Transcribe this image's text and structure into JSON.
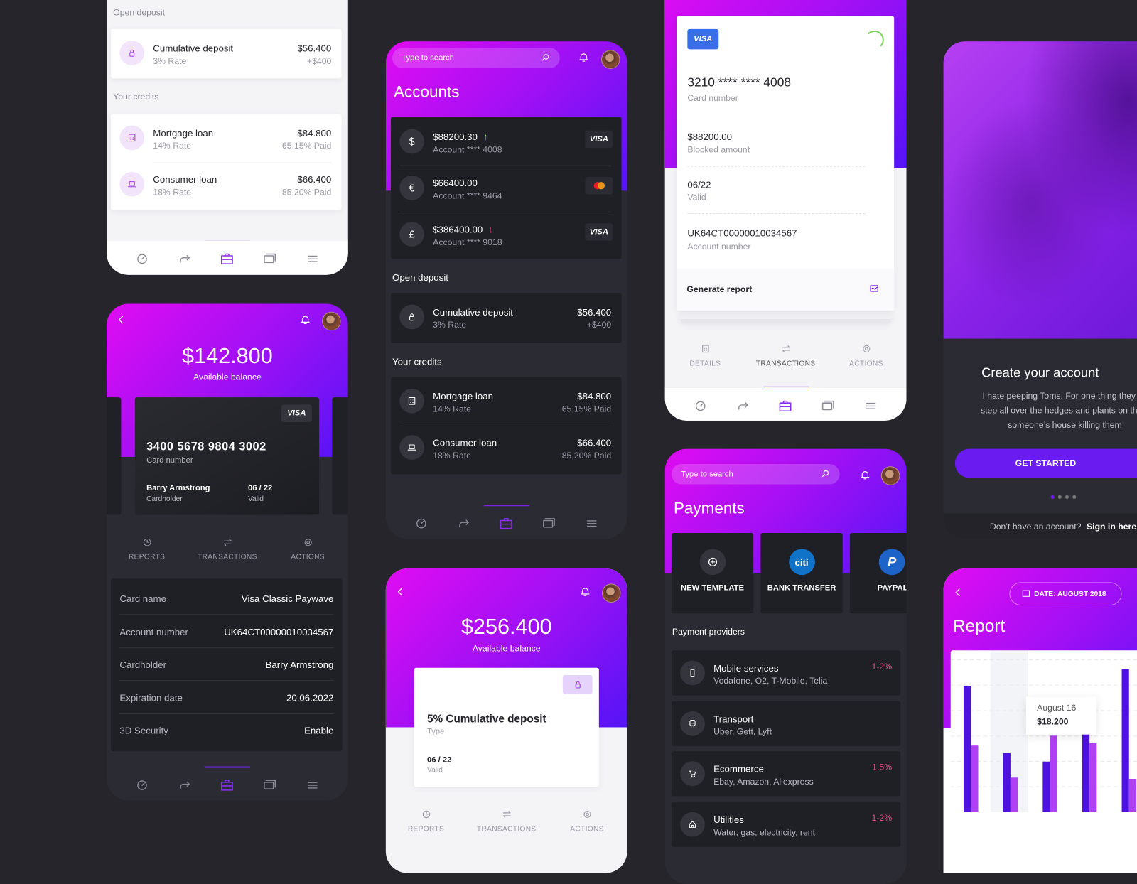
{
  "colors": {
    "gradient_start": "#e00cf2",
    "gradient_end": "#5415f6",
    "accent": "#7a24f0",
    "dark_card": "#1f2026",
    "screen_dark": "#2b2c33",
    "positive": "#7bd35a",
    "negative": "#e8508a"
  },
  "top_left": {
    "open_deposit_label": "Open deposit",
    "deposit": {
      "title": "Cumulative deposit",
      "rate": "3% Rate",
      "amount": "$56.400",
      "change": "+$400",
      "icon": "lock-icon"
    },
    "credits_label": "Your credits",
    "credits": [
      {
        "title": "Mortgage loan",
        "rate": "14% Rate",
        "amount": "$84.800",
        "paid": "65,15% Paid",
        "icon": "building-icon"
      },
      {
        "title": "Consumer loan",
        "rate": "18% Rate",
        "amount": "$66.400",
        "paid": "85,20% Paid",
        "icon": "laptop-icon"
      }
    ]
  },
  "nav": {
    "items": [
      "dashboard",
      "transfer",
      "portfolio",
      "cards",
      "menu"
    ],
    "active": "portfolio"
  },
  "card_detail": {
    "balance": "$142.800",
    "balance_label": "Available balance",
    "card": {
      "brand": "VISA",
      "number": "3400  5678  9804  3002",
      "number_label": "Card number",
      "holder": "Barry Armstrong",
      "holder_label": "Cardholder",
      "expiry": "06 / 22",
      "expiry_label": "Valid"
    },
    "tabs": [
      "REPORTS",
      "TRANSACTIONS",
      "ACTIONS"
    ],
    "details": [
      {
        "key": "Card name",
        "value": "Visa Classic Paywave"
      },
      {
        "key": "Account number",
        "value": "UK64CT00000010034567"
      },
      {
        "key": "Cardholder",
        "value": "Barry Armstrong"
      },
      {
        "key": "Expiration date",
        "value": "20.06.2022"
      },
      {
        "key": "3D Security",
        "value": "Enable"
      }
    ]
  },
  "accounts": {
    "search_placeholder": "Type to search",
    "title": "Accounts",
    "items": [
      {
        "currency": "$",
        "amount": "$88200.30",
        "trend": "up",
        "account": "Account **** 4008",
        "brand": "VISA"
      },
      {
        "currency": "€",
        "amount": "$66400.00",
        "trend": "",
        "account": "Account **** 9464",
        "brand": "mastercard"
      },
      {
        "currency": "£",
        "amount": "$386400.00",
        "trend": "down",
        "account": "Account **** 9018",
        "brand": "VISA"
      }
    ],
    "open_deposit_label": "Open deposit",
    "deposit": {
      "title": "Cumulative deposit",
      "rate": "3% Rate",
      "amount": "$56.400",
      "change": "+$400"
    },
    "credits_label": "Your credits",
    "credits": [
      {
        "title": "Mortgage loan",
        "rate": "14% Rate",
        "amount": "$84.800",
        "paid": "65,15% Paid"
      },
      {
        "title": "Consumer loan",
        "rate": "18% Rate",
        "amount": "$66.400",
        "paid": "85,20% Paid"
      }
    ]
  },
  "deposit_detail": {
    "balance": "$256.400",
    "balance_label": "Available balance",
    "title": "5% Cumulative deposit",
    "type_label": "Type",
    "expiry": "06 / 22",
    "expiry_label": "Valid",
    "tabs": [
      "REPORTS",
      "TRANSACTIONS",
      "ACTIONS"
    ]
  },
  "card_info": {
    "brand": "VISA",
    "number": "3210 **** **** 4008",
    "number_label": "Card number",
    "blocked": "$88200.00",
    "blocked_label": "Blocked amount",
    "valid": "06/22",
    "valid_label": "Valid",
    "account": "UK64CT00000010034567",
    "account_label": "Account number",
    "generate_report": "Generate report",
    "tabs": [
      "DETAILS",
      "TRANSACTIONS",
      "ACTIONS"
    ],
    "active_tab": "TRANSACTIONS"
  },
  "payments": {
    "search_placeholder": "Type to search",
    "title": "Payments",
    "tiles": [
      {
        "label": "NEW TEMPLATE",
        "icon": "plus-circle-icon"
      },
      {
        "label": "BANK TRANSFER",
        "logo": "citi"
      },
      {
        "label": "PAYPAL",
        "logo": "P"
      }
    ],
    "providers_label": "Payment providers",
    "providers": [
      {
        "title": "Mobile services",
        "sub": "Vodafone, O2, T-Mobile, Telia",
        "pct": "1-2%",
        "icon": "phone-icon"
      },
      {
        "title": "Transport",
        "sub": "Uber, Gett, Lyft",
        "pct": "",
        "icon": "bus-icon"
      },
      {
        "title": "Ecommerce",
        "sub": "Ebay, Amazon, Aliexpress",
        "pct": "1.5%",
        "icon": "cart-icon"
      },
      {
        "title": "Utilities",
        "sub": "Water, gas, electricity, rent",
        "pct": "1-2%",
        "icon": "home-icon"
      }
    ]
  },
  "onboarding": {
    "title": "Create your account",
    "text": [
      "I hate peeping Toms. For one thing they us",
      "step all over the hedges and plants on the s",
      "someone’s house killing them"
    ],
    "cta": "GET STARTED",
    "pages": 4,
    "current_page": 1,
    "footer_text": "Don’t have an account?",
    "footer_link": "Sign in here"
  },
  "report": {
    "date_label": "DATE:  AUGUST 2018",
    "title": "Report",
    "tooltip": {
      "date": "August 16",
      "value": "$18.200"
    },
    "series_a": [
      51,
      24,
      20.5,
      35,
      58
    ],
    "series_b": [
      27,
      14,
      31,
      28,
      13.5
    ],
    "series_a_color": "#4e12e0",
    "series_b_color": "#b040f5"
  }
}
